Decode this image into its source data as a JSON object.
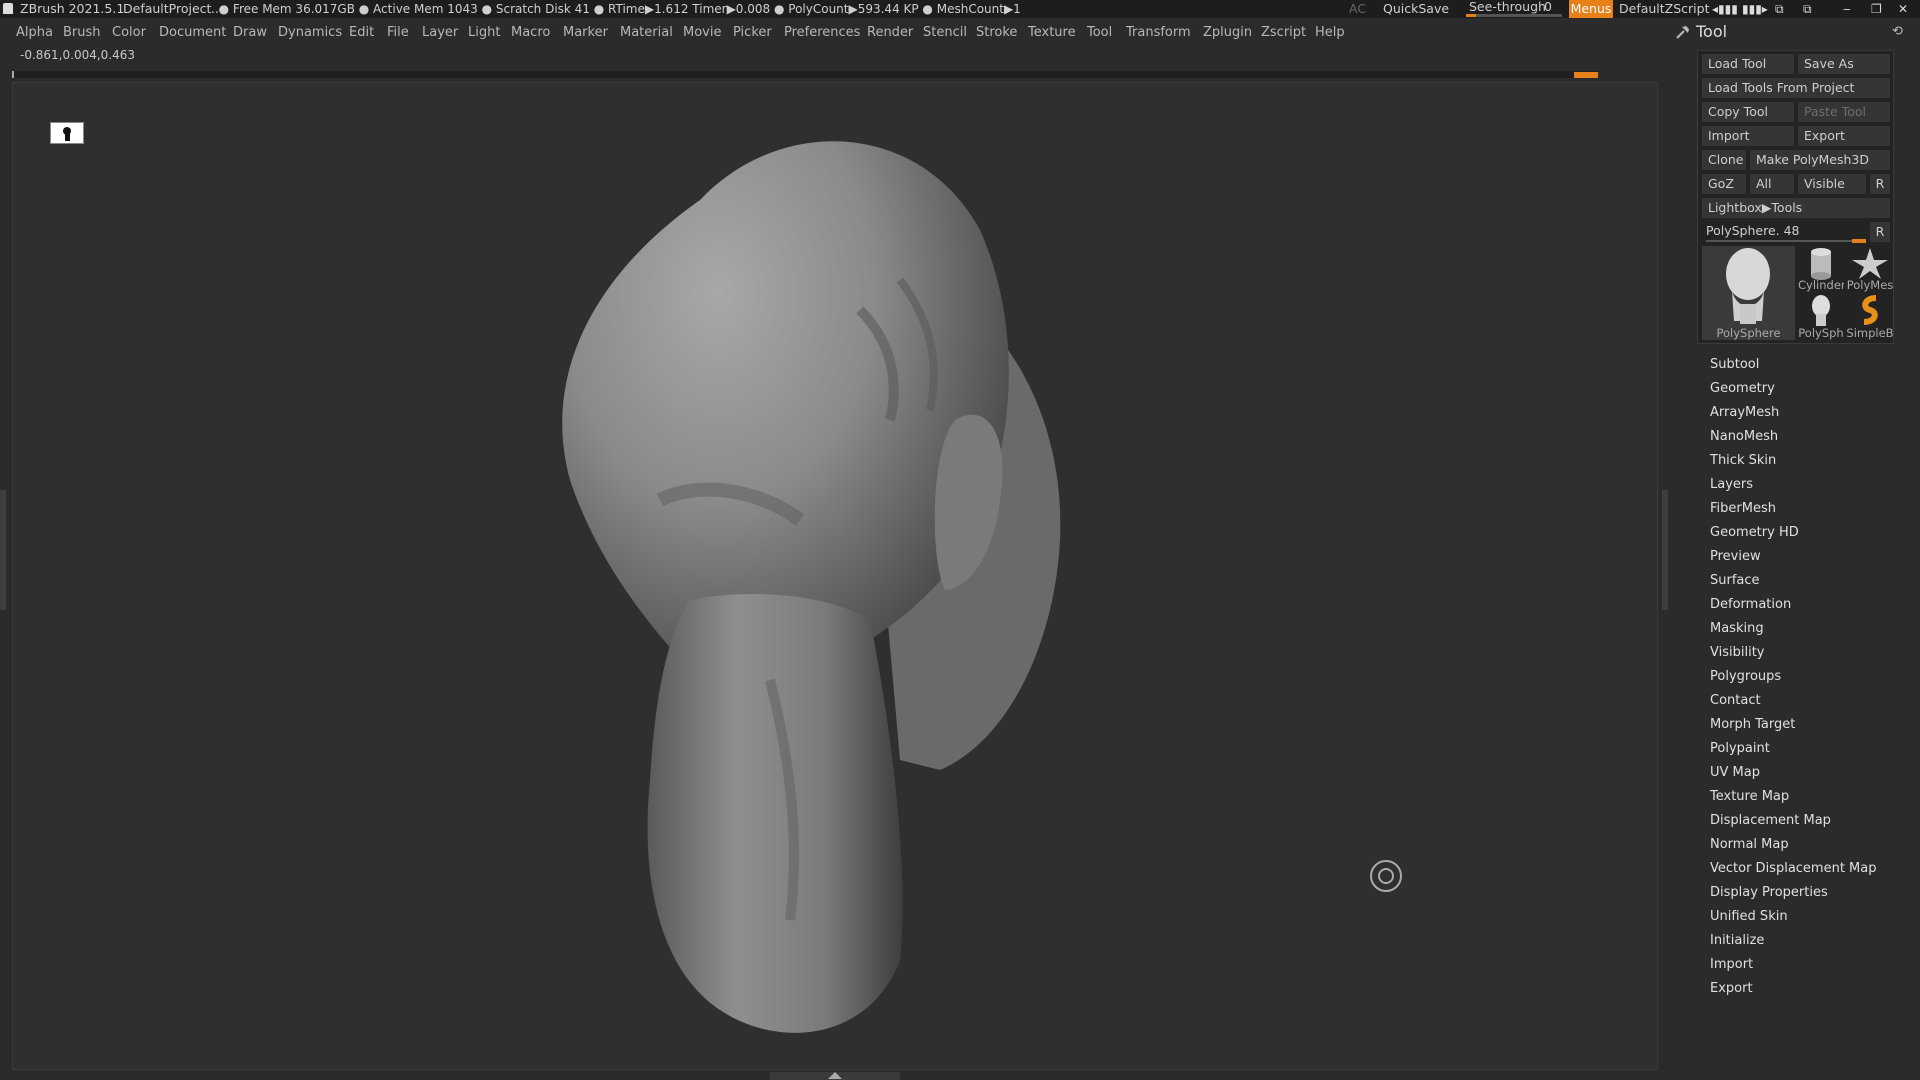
{
  "titlebar": {
    "app": "ZBrush 2021.5.1",
    "project": "DefaultProject",
    "stats": "..● Free Mem 36.017GB ● Active Mem 1043 ● Scratch Disk 41 ●  RTime▶1.612 Timer▶0.008 ● PolyCount▶593.44 KP  ● MeshCount▶1",
    "ac": "AC",
    "quicksave": "QuickSave",
    "see_through_label": "See-through",
    "see_through_value": "0",
    "see_through_level": 0,
    "menus": "Menus",
    "zscript": "DefaultZScript"
  },
  "menubar": [
    "Alpha",
    "Brush",
    "Color",
    "Document",
    "Draw",
    "Dynamics",
    "Edit",
    "File",
    "Layer",
    "Light",
    "Macro",
    "Marker",
    "Material",
    "Movie",
    "Picker",
    "Preferences",
    "Render",
    "Stencil",
    "Stroke",
    "Texture",
    "Tool",
    "Transform",
    "Zplugin",
    "Zscript",
    "Help"
  ],
  "coords": "-0.861,0.004,0.463",
  "tool_palette": {
    "title": "Tool",
    "load_tool": "Load Tool",
    "save_as": "Save As",
    "load_from_project": "Load Tools From Project",
    "copy_tool": "Copy Tool",
    "paste_tool": "Paste Tool",
    "import": "Import",
    "export": "Export",
    "clone": "Clone",
    "make_polymesh": "Make PolyMesh3D",
    "goz": "GoZ",
    "all": "All",
    "visible": "Visible",
    "r": "R",
    "lightbox_tools": "Lightbox▶Tools",
    "polysphere_slider_label": "PolySphere. 48",
    "polysphere_level": 0.9,
    "slider_r": "R",
    "thumbs": {
      "polysphere": "PolySphere",
      "cylinder": "Cylinder",
      "polymesh": "PolyMes",
      "polysph_small": "PolySph",
      "simpleb": "SimpleB"
    },
    "subpalettes": [
      "Subtool",
      "Geometry",
      "ArrayMesh",
      "NanoMesh",
      "Thick Skin",
      "Layers",
      "FiberMesh",
      "Geometry HD",
      "Preview",
      "Surface",
      "Deformation",
      "Masking",
      "Visibility",
      "Polygroups",
      "Contact",
      "Morph Target",
      "Polypaint",
      "UV Map",
      "Texture Map",
      "Displacement Map",
      "Normal Map",
      "Vector Displacement Map",
      "Display Properties",
      "Unified Skin",
      "Initialize",
      "Import",
      "Export"
    ]
  },
  "colors": {
    "accent": "#e8801a",
    "canvas": "#2f2f2f",
    "panel": "#2b2b2b"
  },
  "icons": {
    "app": "zbrush-app-icon",
    "tool": "hammer-icon",
    "canvas_lock": "keyhole-icon",
    "cursor": "brush-cursor-icon"
  }
}
